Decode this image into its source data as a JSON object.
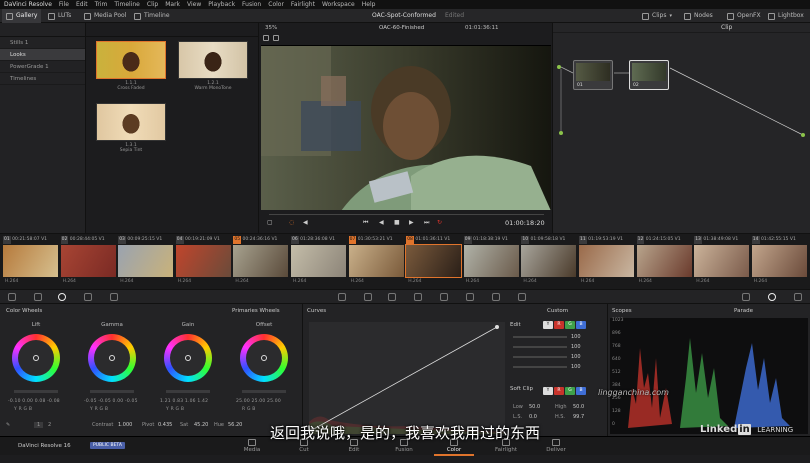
{
  "menubar": [
    "DaVinci Resolve",
    "File",
    "Edit",
    "Trim",
    "Timeline",
    "Clip",
    "Mark",
    "View",
    "Playback",
    "Fusion",
    "Color",
    "Fairlight",
    "Workspace",
    "Help"
  ],
  "toolbar": {
    "gallery": "Gallery",
    "luts": "LUTs",
    "media_pool": "Media Pool",
    "timeline": "Timeline",
    "project_title": "OAC-Spot-Conformed",
    "project_status": "Edited",
    "clips": "Clips",
    "nodes": "Nodes",
    "openfx": "OpenFX",
    "lightbox": "Lightbox"
  },
  "left_panel": {
    "items": [
      "Stills 1",
      "Looks",
      "PowerGrade 1",
      "Timelines"
    ]
  },
  "gallery": {
    "stills": [
      {
        "label_line1": "1.1.1",
        "label_line2": "Cross Faded"
      },
      {
        "label_line1": "1.2.1",
        "label_line2": "Warm MonoTone"
      },
      {
        "label_line1": "1.3.1",
        "label_line2": "Sepia Tint"
      }
    ]
  },
  "viewer": {
    "zoom": "35%",
    "clip_name": "OAC-60-Finished",
    "timecode_top": "01:01:36:11",
    "timecode": "01:00:18:20"
  },
  "nodes_panel": {
    "mode": "Clip",
    "node1_label": "01",
    "node2_label": "02"
  },
  "timeline_clips": [
    {
      "num": "01",
      "tc": "00:21:58:07",
      "track": "V1",
      "codec": "H.264"
    },
    {
      "num": "02",
      "tc": "00:28:44:05",
      "track": "V1",
      "codec": "H.264"
    },
    {
      "num": "03",
      "tc": "00:09:25:15",
      "track": "V1",
      "codec": "H.264"
    },
    {
      "num": "04",
      "tc": "00:19:21:09",
      "track": "V1",
      "codec": "H.264"
    },
    {
      "num": "05",
      "tc": "00:24:36:16",
      "track": "V1",
      "codec": "H.264"
    },
    {
      "num": "06",
      "tc": "01:28:36:08",
      "track": "V1",
      "codec": "H.264"
    },
    {
      "num": "07",
      "tc": "01:30:53:21",
      "track": "V1",
      "codec": "H.264"
    },
    {
      "num": "08",
      "tc": "01:01:36:11",
      "track": "V1",
      "codec": "H.264"
    },
    {
      "num": "09",
      "tc": "01:18:38:19",
      "track": "V1",
      "codec": "H.264"
    },
    {
      "num": "10",
      "tc": "01:09:58:18",
      "track": "V1",
      "codec": "H.264"
    },
    {
      "num": "11",
      "tc": "01:19:53:19",
      "track": "V1",
      "codec": "H.264"
    },
    {
      "num": "12",
      "tc": "01:24:15:05",
      "track": "V1",
      "codec": "H.264"
    },
    {
      "num": "13",
      "tc": "01:38:49:08",
      "track": "V1",
      "codec": "H.264"
    },
    {
      "num": "14",
      "tc": "01:42:55:15",
      "track": "V1",
      "codec": "H.264"
    }
  ],
  "color_wheels": {
    "title": "Color Wheels",
    "mode": "Primaries Wheels",
    "wheels": [
      {
        "name": "Lift",
        "values": "-0.10  0.00  0.08  -0.08",
        "channels": "Y    R    G    B"
      },
      {
        "name": "Gamma",
        "values": "-0.05  -0.05  0.00  -0.05",
        "channels": "Y    R    G    B"
      },
      {
        "name": "Gain",
        "values": "1.21  0.83  1.06  1.42",
        "channels": "Y    R    G    B"
      },
      {
        "name": "Offset",
        "values": "25.00  25.00  25.00",
        "channels": "R    G    B"
      }
    ],
    "page_a": "1",
    "page_b": "2",
    "contrast_label": "Contrast",
    "contrast_value": "1.000",
    "pivot_label": "Pivot",
    "pivot_value": "0.435",
    "sat_label": "Sat",
    "sat_value": "45.20",
    "hue_label": "Hue",
    "hue_value": "56.20"
  },
  "curves": {
    "title": "Curves",
    "mode": "Custom",
    "edit_label": "Edit",
    "channel_values": [
      "100",
      "100",
      "100",
      "100"
    ],
    "soft_clip_label": "Soft Clip",
    "low_label": "Low",
    "low_value": "50.0",
    "high_label": "High",
    "high_value": "50.0",
    "ls_label": "L.S.",
    "ls_value": "0.0",
    "hs_label": "H.S.",
    "hs_value": "99.7",
    "swatches": [
      "Y",
      "R",
      "G",
      "B"
    ]
  },
  "scopes": {
    "title": "Scopes",
    "mode": "Parade",
    "ticks": [
      "1023",
      "896",
      "768",
      "640",
      "512",
      "384",
      "256",
      "128",
      "0"
    ]
  },
  "bottombar": {
    "app": "DaVinci Resolve 16",
    "badge": "PUBLIC BETA",
    "pages": [
      "Media",
      "Cut",
      "Edit",
      "Fusion",
      "Color",
      "Fairlight",
      "Deliver"
    ],
    "active_page": "Color"
  },
  "subtitle": "返回我说哦，是的，我喜欢我用过的东西",
  "watermark": {
    "linkedin": "Linked",
    "in": "in",
    "learning": "LEARNING",
    "site": "lingganchina.com"
  },
  "colors": {
    "accent": "#e0742c",
    "panel": "#232325",
    "bg": "#1d1d1f"
  }
}
